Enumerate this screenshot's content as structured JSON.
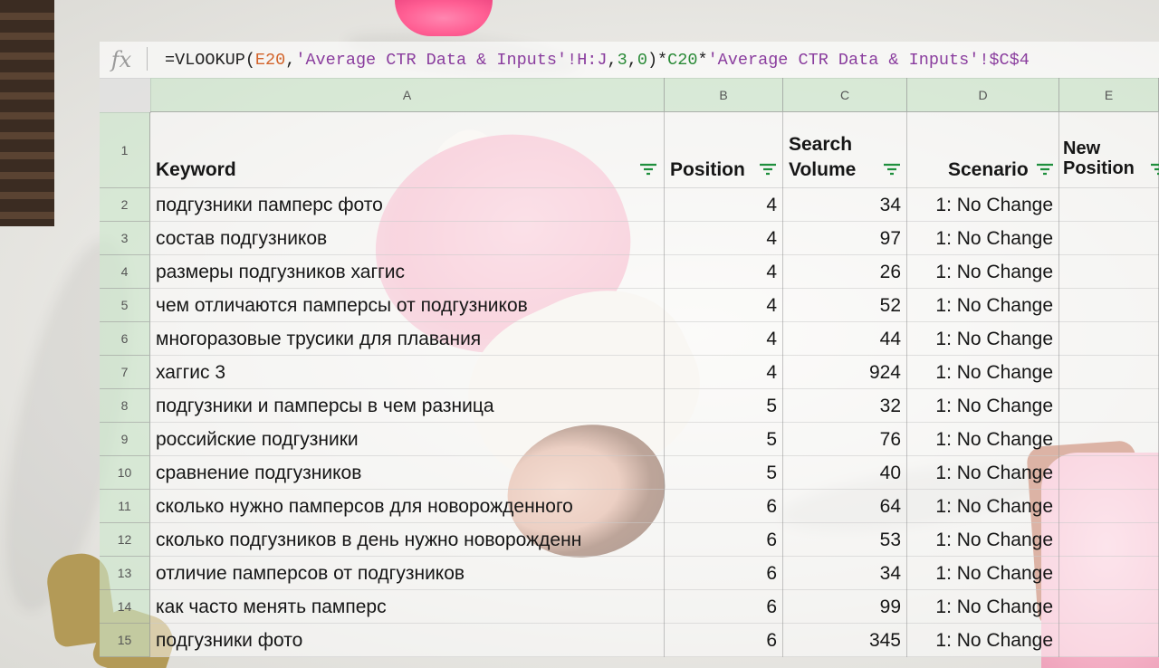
{
  "formula_bar": {
    "fx": "fx",
    "segments": [
      {
        "text": "=VLOOKUP(",
        "cls": ""
      },
      {
        "text": "E20",
        "cls": "f-ref1"
      },
      {
        "text": ",",
        "cls": ""
      },
      {
        "text": "'Average CTR Data & Inputs'!H:J",
        "cls": "f-str"
      },
      {
        "text": ",",
        "cls": ""
      },
      {
        "text": "3",
        "cls": "f-num"
      },
      {
        "text": ",",
        "cls": ""
      },
      {
        "text": "0",
        "cls": "f-num"
      },
      {
        "text": ")*",
        "cls": ""
      },
      {
        "text": "C20",
        "cls": "f-ref2"
      },
      {
        "text": "*",
        "cls": ""
      },
      {
        "text": "'Average CTR Data & Inputs'!$C$4",
        "cls": "f-str"
      }
    ]
  },
  "columns": [
    "A",
    "B",
    "C",
    "D",
    "E"
  ],
  "header_row": {
    "number": "1",
    "keyword": "Keyword",
    "position": "Position",
    "search_volume_line1": "Search",
    "search_volume_line2": "Volume",
    "scenario": "Scenario",
    "new_position_line1": "New",
    "new_position_line2": "Position"
  },
  "rows": [
    {
      "n": "2",
      "keyword": "подгузники памперс фото",
      "position": "4",
      "volume": "34",
      "scenario": "1: No Change"
    },
    {
      "n": "3",
      "keyword": "состав подгузников",
      "position": "4",
      "volume": "97",
      "scenario": "1: No Change"
    },
    {
      "n": "4",
      "keyword": "размеры подгузников хаггис",
      "position": "4",
      "volume": "26",
      "scenario": "1: No Change"
    },
    {
      "n": "5",
      "keyword": "чем отличаются памперсы от подгузников",
      "position": "4",
      "volume": "52",
      "scenario": "1: No Change"
    },
    {
      "n": "6",
      "keyword": "многоразовые трусики для плавания",
      "position": "4",
      "volume": "44",
      "scenario": "1: No Change"
    },
    {
      "n": "7",
      "keyword": "хаггис 3",
      "position": "4",
      "volume": "924",
      "scenario": "1: No Change"
    },
    {
      "n": "8",
      "keyword": "подгузники и памперсы в чем разница",
      "position": "5",
      "volume": "32",
      "scenario": "1: No Change"
    },
    {
      "n": "9",
      "keyword": "российские подгузники",
      "position": "5",
      "volume": "76",
      "scenario": "1: No Change"
    },
    {
      "n": "10",
      "keyword": "сравнение подгузников",
      "position": "5",
      "volume": "40",
      "scenario": "1: No Change"
    },
    {
      "n": "11",
      "keyword": "сколько нужно памперсов для новорожденного",
      "position": "6",
      "volume": "64",
      "scenario": "1: No Change"
    },
    {
      "n": "12",
      "keyword": "сколько подгузников в день нужно новорожденн",
      "position": "6",
      "volume": "53",
      "scenario": "1: No Change"
    },
    {
      "n": "13",
      "keyword": "отличие памперсов от подгузников",
      "position": "6",
      "volume": "34",
      "scenario": "1: No Change"
    },
    {
      "n": "14",
      "keyword": "как часто менять памперс",
      "position": "6",
      "volume": "99",
      "scenario": "1: No Change"
    },
    {
      "n": "15",
      "keyword": "подгузники фото",
      "position": "6",
      "volume": "345",
      "scenario": "1: No Change"
    }
  ]
}
